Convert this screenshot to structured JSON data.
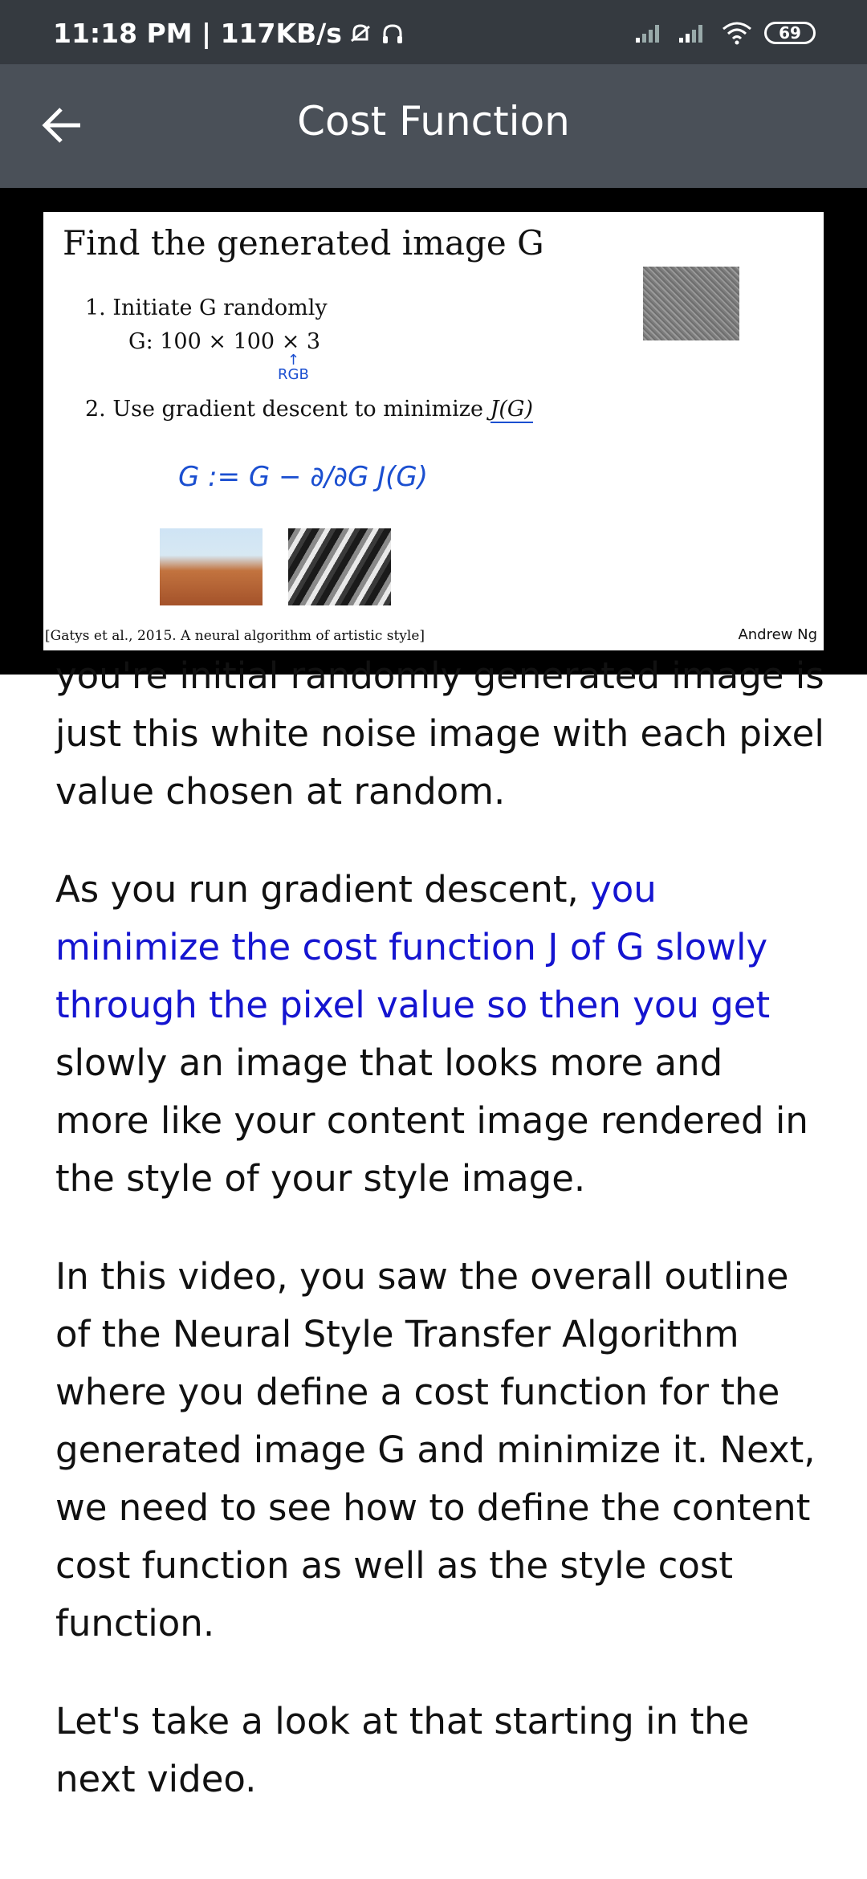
{
  "status_bar": {
    "time_speed": "11:18 PM | 117KB/s",
    "battery": "69"
  },
  "app_bar": {
    "title": "Cost Function"
  },
  "slide": {
    "title": "Find the generated image G",
    "step1": "1. Initiate G randomly",
    "dimensions": "G: 100 × 100 × 3",
    "rgb_note": "RGB",
    "step2_prefix": "2. Use gradient descent to minimize",
    "step2_formula": "J(G)",
    "handwriting": "G := G − ∂/∂G J(G)",
    "citation": "[Gatys et al., 2015. A neural algorithm of artistic style]",
    "author": "Andrew Ng"
  },
  "transcript": {
    "p1": "you're initial randomly generated image is just this white noise image with each pixel value chosen at random.",
    "p2_start": "As you run gradient descent, ",
    "p2_highlight": "you minimize the cost function J of G slowly through the pixel value so then you get",
    "p2_end": " slowly an image that looks more and more like your content image rendered in the style of your style image.",
    "p3": "In this video, you saw the overall outline of the Neural Style Transfer Algorithm where you define a cost function for the generated image G and minimize it. Next, we need to see how to define the content cost function as well as the style cost function.",
    "p4": "Let's take a look at that starting in the next video."
  },
  "colors": {
    "status_bar_bg": "#353a40",
    "app_bar_bg": "#4a5058",
    "highlight_text": "#1414d0"
  }
}
